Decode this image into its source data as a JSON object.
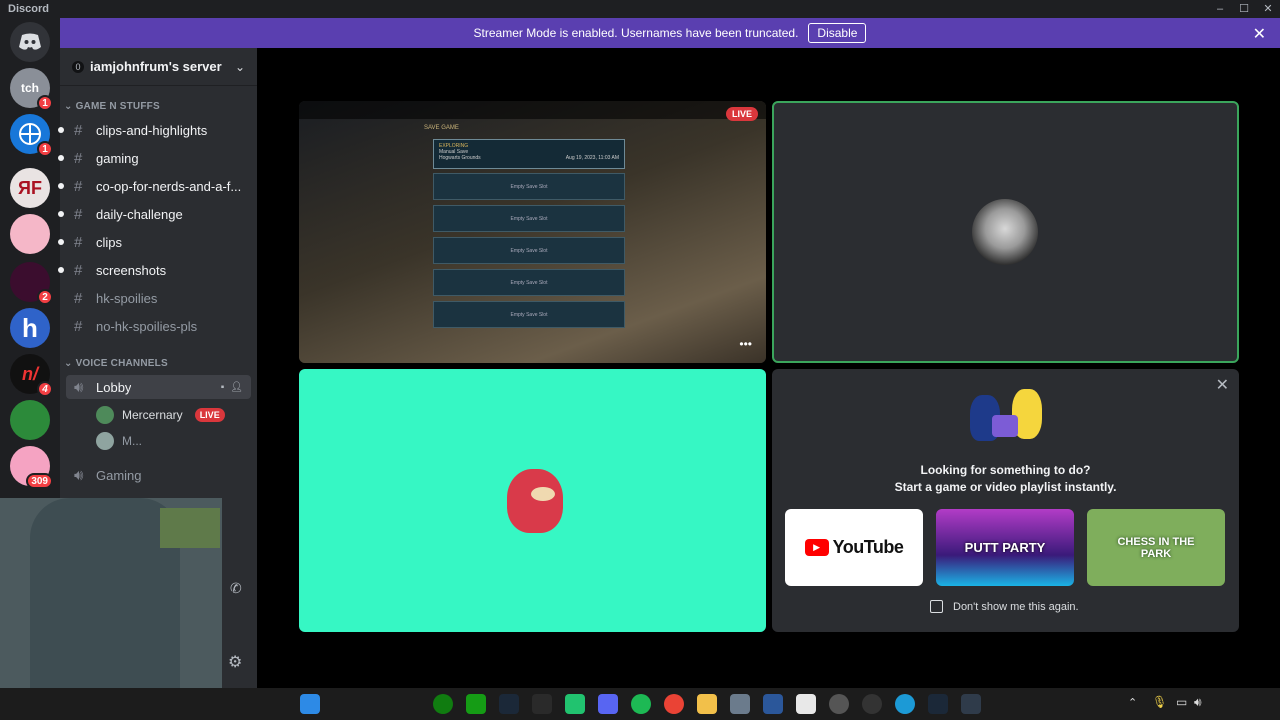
{
  "app": {
    "name": "Discord"
  },
  "window_controls": {
    "minimize": "–",
    "maximize": "☐",
    "close": "✕"
  },
  "banner": {
    "text": "Streamer Mode is enabled. Usernames have been truncated.",
    "disable_label": "Disable"
  },
  "servers": [
    {
      "badge": "1"
    },
    {
      "badge": "1"
    },
    {
      "badge": ""
    },
    {
      "badge": ""
    },
    {
      "badge": "2"
    },
    {
      "badge": ""
    },
    {
      "badge": "4"
    },
    {
      "badge": ""
    },
    {
      "badge": "309"
    }
  ],
  "server": {
    "name": "iamjohnfrum's server",
    "badge": "0"
  },
  "categories": {
    "text": "GAME N STUFFS",
    "voice": "VOICE CHANNELS"
  },
  "text_channels": [
    "clips-and-highlights",
    "gaming",
    "co-op-for-nerds-and-a-f...",
    "daily-challenge",
    "clips",
    "screenshots",
    "hk-spoilies",
    "no-hk-spoilies-pls"
  ],
  "voice_channels": {
    "lobby": "Lobby",
    "gaming": "Gaming",
    "members": [
      {
        "name": "Mercernary",
        "live": "LIVE"
      },
      {
        "name": "M..."
      }
    ]
  },
  "stage": {
    "game": {
      "live": "LIVE",
      "menu": "SAVE GAME",
      "slot_header": "EXPLORING",
      "slot_sub": "Manual Save",
      "slot_location": "Hogwarts Grounds",
      "slot_date": "Aug 19, 2023, 11:03 AM",
      "empty_slots": [
        "Empty Save Slot",
        "Empty Save Slot",
        "Empty Save Slot",
        "Empty Save Slot",
        "Empty Save Slot"
      ]
    },
    "activity": {
      "line1": "Looking for something to do?",
      "line2": "Start a game or video playlist instantly.",
      "cards": [
        "YouTube",
        "PUTT PARTY",
        "CHESS IN THE PARK"
      ],
      "dont_show": "Don't show me this again."
    }
  },
  "colors": {
    "banner": "#5a3fb0",
    "speaking_border": "#3ba55c",
    "teal_tile": "#36f7c4",
    "live": "#da373c"
  }
}
